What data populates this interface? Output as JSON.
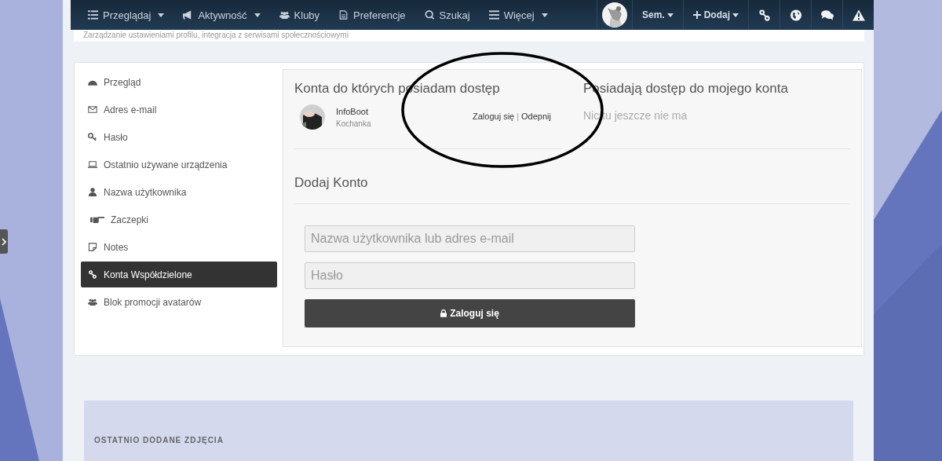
{
  "navbar": {
    "items": [
      {
        "label": "Przeglądaj",
        "kind": "list",
        "dropdown": true
      },
      {
        "label": "Aktywność",
        "kind": "megaphone",
        "dropdown": true
      },
      {
        "label": "Kluby",
        "kind": "users",
        "dropdown": false
      },
      {
        "label": "Preferencje",
        "kind": "document",
        "dropdown": false
      },
      {
        "label": "Szukaj",
        "kind": "search",
        "dropdown": false
      },
      {
        "label": "Więcej",
        "kind": "menu",
        "dropdown": true
      }
    ],
    "user": {
      "name": "Sem.",
      "dropdown": true
    },
    "add": {
      "label": "Dodaj",
      "dropdown": true
    },
    "tools": [
      {
        "kind": "link"
      },
      {
        "kind": "globe"
      },
      {
        "kind": "chat"
      },
      {
        "kind": "warning"
      }
    ]
  },
  "subtitle": "Zarządzanie ustawieniami profilu, integracja z serwisami społecznościowymi",
  "sidebar": {
    "items": [
      {
        "label": "Przegląd",
        "kind": "gauge",
        "selected": false
      },
      {
        "label": "Adres e-mail",
        "kind": "envelope",
        "selected": false
      },
      {
        "label": "Hasło",
        "kind": "key",
        "selected": false
      },
      {
        "label": "Ostatnio używane urządzenia",
        "kind": "laptop",
        "selected": false
      },
      {
        "label": "Nazwa użytkownika",
        "kind": "user",
        "selected": false
      },
      {
        "label": "Zaczepki",
        "kind": "hand",
        "selected": false
      },
      {
        "label": "Notes",
        "kind": "note",
        "selected": false
      },
      {
        "label": "Konta Współdzielone",
        "kind": "link",
        "selected": true
      },
      {
        "label": "Blok promocji avatarów",
        "kind": "users",
        "selected": false
      }
    ]
  },
  "my_accounts": {
    "title": "Konta do których posiadam dostęp",
    "accounts": [
      {
        "name": "InfoBoot",
        "role": "Kochanka",
        "login": "Zaloguj się",
        "separator": "|",
        "unlink": "Odepnij"
      }
    ]
  },
  "access": {
    "title": "Posiadają dostęp do mojego konta",
    "empty": "Nic tu jeszcze nie ma"
  },
  "add_account": {
    "title": "Dodaj Konto",
    "username": {
      "placeholder": "Nazwa użytkownika lub adres e-mail"
    },
    "password": {
      "placeholder": "Hasło"
    },
    "submit": "Zaloguj się"
  },
  "recent_photos": {
    "title": "OSTATNIO DODANE ZDJĘCIA"
  }
}
